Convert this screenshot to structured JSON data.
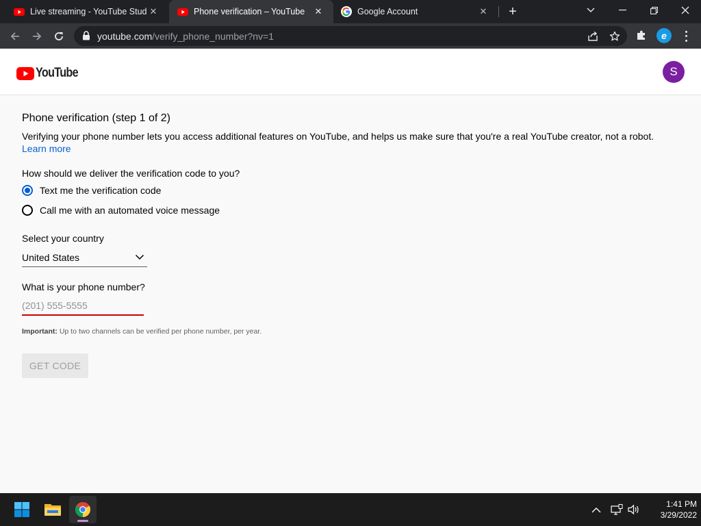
{
  "browser": {
    "tabs": [
      {
        "title": "Live streaming - YouTube Studio",
        "favicon": "youtube-icon",
        "active": false
      },
      {
        "title": "Phone verification – YouTube",
        "favicon": "youtube-icon",
        "active": true
      },
      {
        "title": "Google Account",
        "favicon": "google-icon",
        "active": false
      }
    ],
    "url_host": "youtube.com",
    "url_path": "/verify_phone_number?nv=1",
    "profile_letter": "e"
  },
  "header": {
    "logo_text": "YouTube",
    "avatar_letter": "S"
  },
  "page": {
    "title": "Phone verification (step 1 of 2)",
    "description": "Verifying your phone number lets you access additional features on YouTube, and helps us make sure that you're a real YouTube creator, not a robot.",
    "learn_more": "Learn more",
    "delivery_question": "How should we deliver the verification code to you?",
    "options": [
      {
        "label": "Text me the verification code",
        "selected": true
      },
      {
        "label": "Call me with an automated voice message",
        "selected": false
      }
    ],
    "country_label": "Select your country",
    "country_value": "United States",
    "phone_label": "What is your phone number?",
    "phone_placeholder": "(201) 555-5555",
    "phone_value": "",
    "note_bold": "Important:",
    "note_text": " Up to two channels can be verified per phone number, per year.",
    "get_code_label": "GET CODE"
  },
  "taskbar": {
    "time": "1:41 PM",
    "date": "3/29/2022"
  },
  "colors": {
    "youtube_red": "#ff0000",
    "link_blue": "#065fd4",
    "avatar_purple": "#7b1fa2",
    "error_red": "#cc0000"
  }
}
